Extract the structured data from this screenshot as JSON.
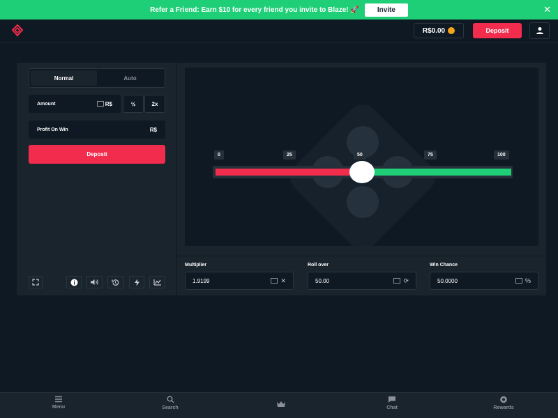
{
  "banner": {
    "text": "Refer a Friend: Earn $10 for every friend you invite to Blaze! 🚀",
    "invite_label": "Invite",
    "close_label": "✕"
  },
  "header": {
    "balance": "R$0.00",
    "deposit_label": "Deposit"
  },
  "controls": {
    "mode_tabs": [
      "Normal",
      "Auto"
    ],
    "active_mode": "Normal",
    "amount_label": "Amount",
    "amount_currency": "R$",
    "half_label": "½",
    "double_label": "2x",
    "profit_label": "Profit On Win",
    "profit_currency": "R$",
    "deposit_label": "Deposit"
  },
  "board": {
    "ticks": [
      "0",
      "25",
      "50",
      "75",
      "100"
    ],
    "slider_value": 50
  },
  "bottom": {
    "multiplier_label": "Multiplier",
    "multiplier_value": "1.9199",
    "multiplier_suffix": "✕",
    "rollover_label": "Roll over",
    "rollover_value": "50.00",
    "rollover_suffix": "⟳",
    "winchance_label": "Win Chance",
    "winchance_value": "50.0000",
    "winchance_suffix": "%"
  },
  "nav": {
    "menu": "Menu",
    "search": "Search",
    "chat": "Chat",
    "rewards": "Rewards"
  },
  "colors": {
    "accent_red": "#f12c4c",
    "accent_green": "#1fcf78",
    "bg_dark": "#0f1923",
    "panel": "#1a242d"
  },
  "icons": [
    "logo-icon",
    "coin-icon",
    "user-icon",
    "fullscreen-icon",
    "info-icon",
    "volume-icon",
    "history-icon",
    "lightning-icon",
    "chart-icon",
    "menu-icon",
    "search-icon",
    "crown-icon",
    "chat-icon",
    "rewards-icon"
  ]
}
